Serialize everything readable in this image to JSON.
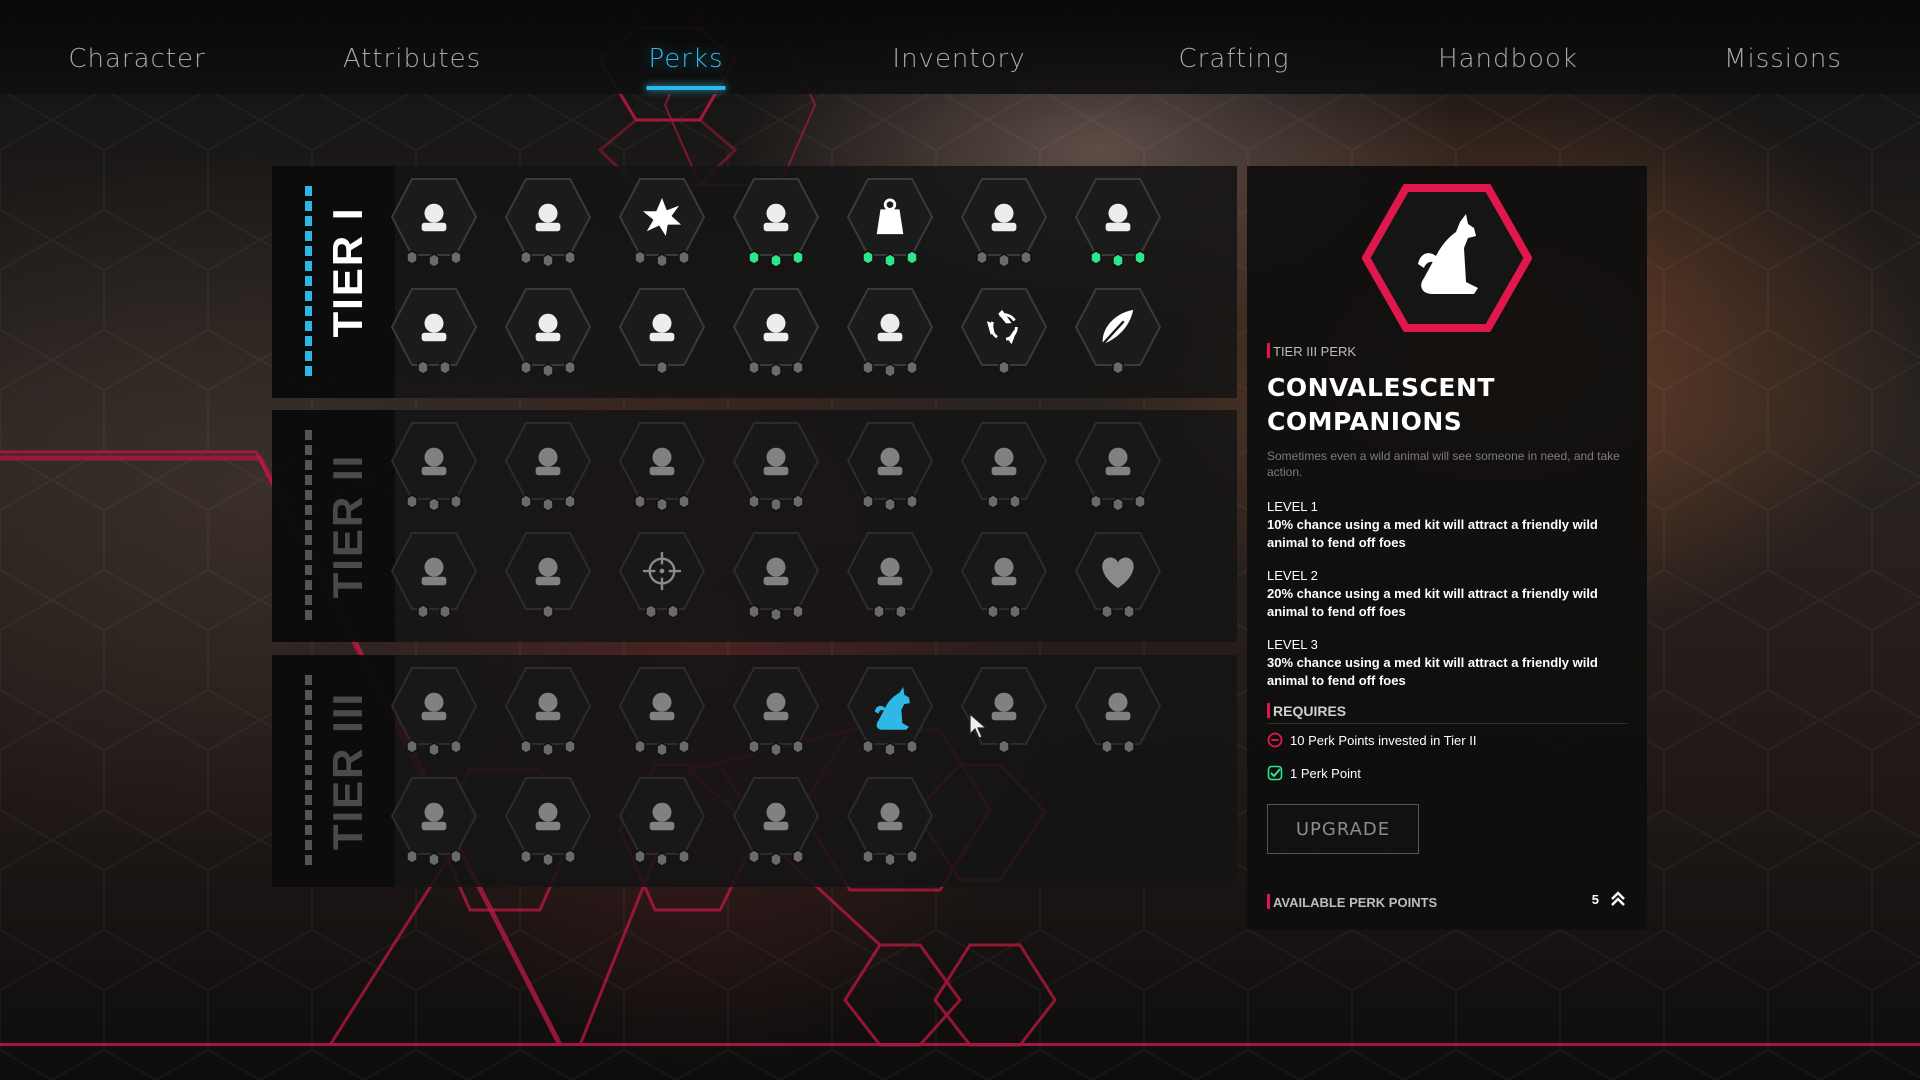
{
  "nav": {
    "tabs": [
      {
        "label": "Character"
      },
      {
        "label": "Attributes"
      },
      {
        "label": "Perks"
      },
      {
        "label": "Inventory"
      },
      {
        "label": "Crafting"
      },
      {
        "label": "Handbook"
      },
      {
        "label": "Missions"
      }
    ],
    "active_tab": "Perks"
  },
  "colors": {
    "accent_blue": "#2fb7e6",
    "accent_red": "#e0174d",
    "unlocked_green": "#2ee68a",
    "pip_gray": "#6a6a6a"
  },
  "tiers": [
    {
      "label": "TIER I",
      "perks": [
        {
          "icon": "bullet-chevron-icon",
          "pips_filled": 0,
          "pips_total": 3
        },
        {
          "icon": "syringe-chain-icon",
          "pips_filled": 0,
          "pips_total": 3
        },
        {
          "icon": "explosion-icon",
          "pips_filled": 0,
          "pips_total": 3
        },
        {
          "icon": "sneaker-icon",
          "pips_filled": 3,
          "pips_total": 3
        },
        {
          "icon": "weight-kg-icon",
          "pips_filled": 3,
          "pips_total": 3
        },
        {
          "icon": "skull-book-icon",
          "pips_filled": 0,
          "pips_total": 3
        },
        {
          "icon": "survivor-arrows-icon",
          "pips_filled": 3,
          "pips_total": 3
        },
        {
          "icon": "toolbox-icon",
          "pips_filled": 0,
          "pips_total": 2
        },
        {
          "icon": "gear-craft-icon",
          "pips_filled": 0,
          "pips_total": 3
        },
        {
          "icon": "person-melee-icon",
          "pips_filled": 0,
          "pips_total": 1
        },
        {
          "icon": "body-armor-icon",
          "pips_filled": 0,
          "pips_total": 3
        },
        {
          "icon": "bullet-sparkle-icon",
          "pips_filled": 0,
          "pips_total": 3
        },
        {
          "icon": "recycle-icon",
          "pips_filled": 0,
          "pips_total": 1
        },
        {
          "icon": "feather-icon",
          "pips_filled": 0,
          "pips_total": 1
        }
      ]
    },
    {
      "label": "TIER II",
      "perks": [
        {
          "icon": "assault-rifle-icon",
          "pips_filled": 0,
          "pips_total": 3
        },
        {
          "icon": "pistol-icon",
          "pips_filled": 0,
          "pips_total": 3
        },
        {
          "icon": "submachine-gun-icon",
          "pips_filled": 0,
          "pips_total": 3
        },
        {
          "icon": "gauge-icon",
          "pips_filled": 0,
          "pips_total": 3
        },
        {
          "icon": "pulley-icon",
          "pips_filled": 0,
          "pips_total": 3
        },
        {
          "icon": "medic-flag-icon",
          "pips_filled": 0,
          "pips_total": 2
        },
        {
          "icon": "hammer-pickaxe-icon",
          "pips_filled": 0,
          "pips_total": 3
        },
        {
          "icon": "turret-icon",
          "pips_filled": 0,
          "pips_total": 2
        },
        {
          "icon": "spider-heart-icon",
          "pips_filled": 0,
          "pips_total": 1
        },
        {
          "icon": "crosshair-icon",
          "pips_filled": 0,
          "pips_total": 2
        },
        {
          "icon": "gas-mask-icon",
          "pips_filled": 0,
          "pips_total": 3
        },
        {
          "icon": "map-icon",
          "pips_filled": 0,
          "pips_total": 2
        },
        {
          "icon": "target-head-icon",
          "pips_filled": 0,
          "pips_total": 2
        },
        {
          "icon": "heart-icon",
          "pips_filled": 0,
          "pips_total": 2
        }
      ]
    },
    {
      "label": "TIER III",
      "perks": [
        {
          "icon": "flare-gun-icon",
          "pips_filled": 0,
          "pips_total": 3
        },
        {
          "icon": "knife-hand-icon",
          "pips_filled": 0,
          "pips_total": 3
        },
        {
          "icon": "cannon-icon",
          "pips_filled": 0,
          "pips_total": 3
        },
        {
          "icon": "running-man-icon",
          "pips_filled": 0,
          "pips_total": 3
        },
        {
          "icon": "dog-icon",
          "pips_filled": 0,
          "pips_total": 3,
          "selected": true
        },
        {
          "icon": "mounted-gun-icon",
          "pips_filled": 0,
          "pips_total": 1
        },
        {
          "icon": "hand-burst-icon",
          "pips_filled": 0,
          "pips_total": 2
        },
        {
          "icon": "shield-person-icon",
          "pips_filled": 0,
          "pips_total": 3
        },
        {
          "icon": "hand-gear-icon",
          "pips_filled": 0,
          "pips_total": 3
        },
        {
          "icon": "weapon-swap-icon",
          "pips_filled": 0,
          "pips_total": 3
        },
        {
          "icon": "sun-gear-icon",
          "pips_filled": 0,
          "pips_total": 3
        },
        {
          "icon": "robot-sparkle-icon",
          "pips_filled": 0,
          "pips_total": 3
        }
      ]
    }
  ],
  "detail": {
    "big_icon": "dog-icon",
    "tier_label": "TIER III PERK",
    "title_line1": "CONVALESCENT",
    "title_line2": "COMPANIONS",
    "description": "Sometimes even a wild animal will see someone in need, and take action.",
    "levels": [
      {
        "heading": "LEVEL 1",
        "text": "10% chance using a med kit will attract a friendly wild animal to fend off foes"
      },
      {
        "heading": "LEVEL 2",
        "text": "20% chance using a med kit will attract a friendly wild animal to fend off foes"
      },
      {
        "heading": "LEVEL 3",
        "text": "30% chance using a med kit will attract a friendly wild animal to fend off foes"
      }
    ],
    "requires_label": "REQUIRES",
    "requirements": [
      {
        "text": "10 Perk Points invested in Tier II",
        "met": false
      },
      {
        "text": "1 Perk Point",
        "met": true
      }
    ],
    "upgrade_label": "UPGRADE",
    "available_label": "AVAILABLE PERK POINTS",
    "available_value": "5"
  }
}
